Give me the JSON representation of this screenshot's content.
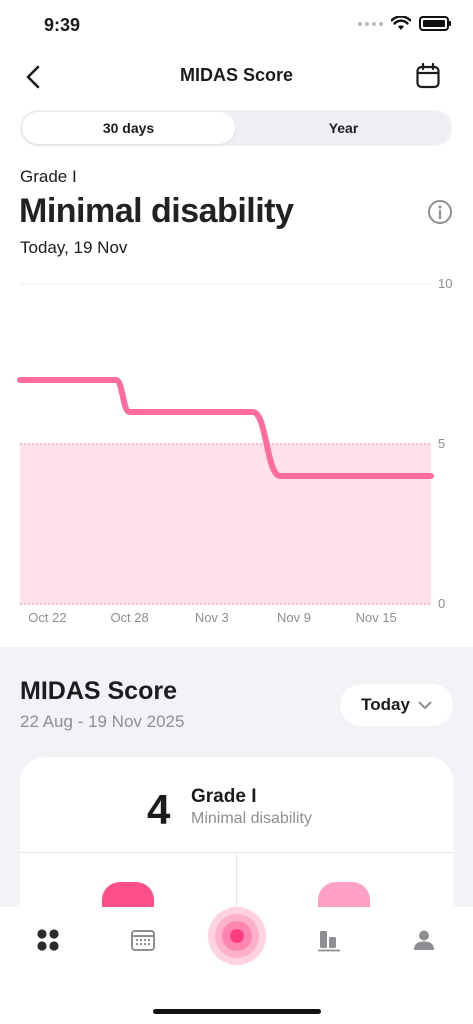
{
  "status_bar": {
    "time": "9:39"
  },
  "nav": {
    "title": "MIDAS Score",
    "back_icon": "chevron-left-icon",
    "calendar_icon": "calendar-icon"
  },
  "tabs": [
    {
      "label": "30 days",
      "active": true
    },
    {
      "label": "Year",
      "active": false
    }
  ],
  "summary": {
    "grade": "Grade I",
    "headline": "Minimal disability",
    "date": "Today, 19 Nov"
  },
  "chart_data": {
    "type": "line",
    "x": [
      "Oct 20",
      "Oct 27",
      "Oct 28",
      "Nov 6",
      "Nov 8",
      "Nov 19"
    ],
    "series": [
      {
        "values": [
          7,
          7,
          6,
          6,
          4,
          4
        ]
      }
    ],
    "x_tick_labels": [
      "Oct 22",
      "Oct 28",
      "Nov 3",
      "Nov 9",
      "Nov 15"
    ],
    "y_tick_labels": [
      "10",
      "5",
      "0"
    ],
    "ylim": [
      0,
      10
    ],
    "shaded_band": [
      0,
      5
    ],
    "line_color": "#ff6b9e",
    "band_color": "#ffe1ea",
    "grid": false
  },
  "section": {
    "title": "MIDAS Score",
    "range": "22 Aug - 19 Nov 2025",
    "period_select": "Today"
  },
  "score_card": {
    "score": "4",
    "grade": "Grade I",
    "description": "Minimal disability"
  },
  "colors": {
    "accent": "#ff4f8b",
    "accent_light": "#ffa0c4",
    "background_gray": "#f2f2f7"
  },
  "tab_bar": [
    {
      "icon": "dashboard-icon"
    },
    {
      "icon": "calendar-grid-icon"
    },
    {
      "icon": "record-button-icon"
    },
    {
      "icon": "stats-icon"
    },
    {
      "icon": "profile-icon"
    }
  ]
}
